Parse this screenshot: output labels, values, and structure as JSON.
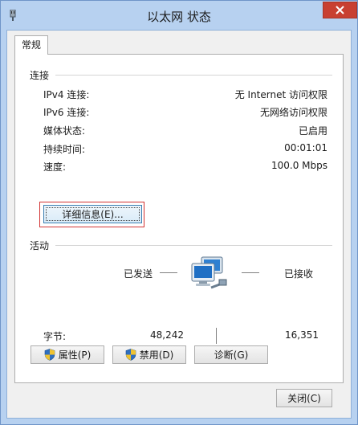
{
  "window": {
    "title": "以太网 状态",
    "close_glyph": "✕"
  },
  "tabs": [
    {
      "label": "常规"
    }
  ],
  "connection": {
    "group_label": "连接",
    "rows": [
      {
        "label": "IPv4 连接:",
        "value": "无 Internet 访问权限"
      },
      {
        "label": "IPv6 连接:",
        "value": "无网络访问权限"
      },
      {
        "label": "媒体状态:",
        "value": "已启用"
      },
      {
        "label": "持续时间:",
        "value": "00:01:01"
      },
      {
        "label": "速度:",
        "value": "100.0 Mbps"
      }
    ],
    "details_button": "详细信息(E)..."
  },
  "activity": {
    "group_label": "活动",
    "sent_label": "已发送",
    "received_label": "已接收",
    "bytes_label": "字节:",
    "bytes_sent": "48,242",
    "bytes_received": "16,351"
  },
  "buttons": {
    "properties": "属性(P)",
    "disable": "禁用(D)",
    "diagnose": "诊断(G)",
    "close": "关闭(C)"
  },
  "icons": {
    "app": "network-adapter-icon",
    "network": "network-computers-icon",
    "shield": "uac-shield-icon"
  },
  "colors": {
    "frame": "#b7d1f0",
    "close_button": "#c84031",
    "panel": "#ffffff",
    "focus_rect": "#d23434"
  }
}
